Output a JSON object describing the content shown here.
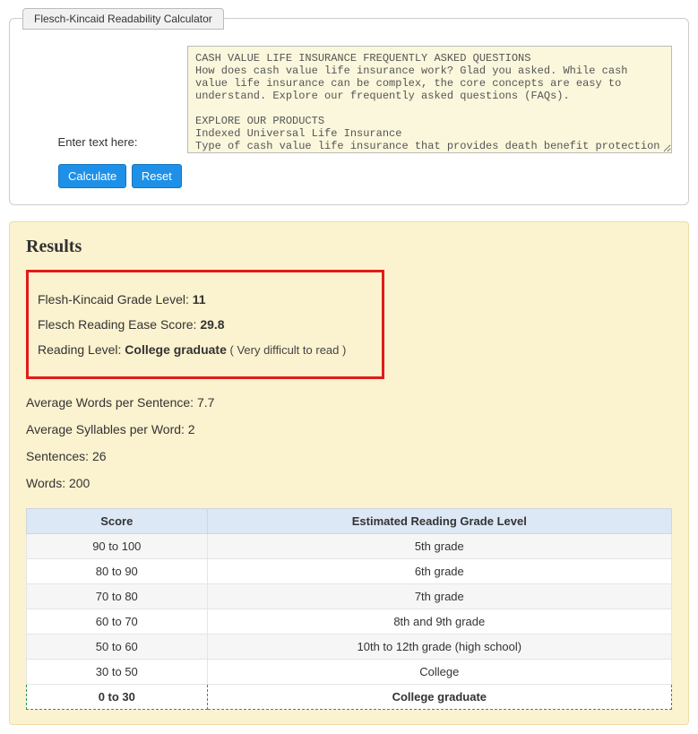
{
  "panel": {
    "tab_label": "Flesch-Kincaid Readability Calculator",
    "input_label": "Enter text here:",
    "textarea_value": "CASH VALUE LIFE INSURANCE FREQUENTLY ASKED QUESTIONS\nHow does cash value life insurance work? Glad you asked. While cash value life insurance can be complex, the core concepts are easy to understand. Explore our frequently asked questions (FAQs).\n\nEXPLORE OUR PRODUCTS\nIndexed Universal Life Insurance\nType of cash value life insurance that provides death benefit protection and",
    "calculate_label": "Calculate",
    "reset_label": "Reset"
  },
  "results": {
    "title": "Results",
    "grade_label": "Flesh-Kincaid Grade Level: ",
    "grade_value": "11",
    "ease_label": "Flesch Reading Ease Score: ",
    "ease_value": "29.8",
    "level_label": "Reading Level: ",
    "level_value": "College graduate",
    "level_note": " ( Very difficult to read )",
    "avg_words_label": "Average Words per Sentence: ",
    "avg_words_value": "7.7",
    "avg_syll_label": "Average Syllables per Word: ",
    "avg_syll_value": "2",
    "sentences_label": "Sentences: ",
    "sentences_value": "26",
    "words_label": "Words: ",
    "words_value": "200"
  },
  "table": {
    "headers": {
      "score": "Score",
      "grade": "Estimated Reading Grade Level"
    },
    "rows": [
      {
        "score": "90 to 100",
        "grade": "5th grade",
        "highlight": false
      },
      {
        "score": "80 to 90",
        "grade": "6th grade",
        "highlight": false
      },
      {
        "score": "70 to 80",
        "grade": "7th grade",
        "highlight": false
      },
      {
        "score": "60 to 70",
        "grade": "8th and 9th grade",
        "highlight": false
      },
      {
        "score": "50 to 60",
        "grade": "10th to 12th grade (high school)",
        "highlight": false
      },
      {
        "score": "30 to 50",
        "grade": "College",
        "highlight": false
      },
      {
        "score": "0 to 30",
        "grade": "College graduate",
        "highlight": true
      }
    ]
  }
}
